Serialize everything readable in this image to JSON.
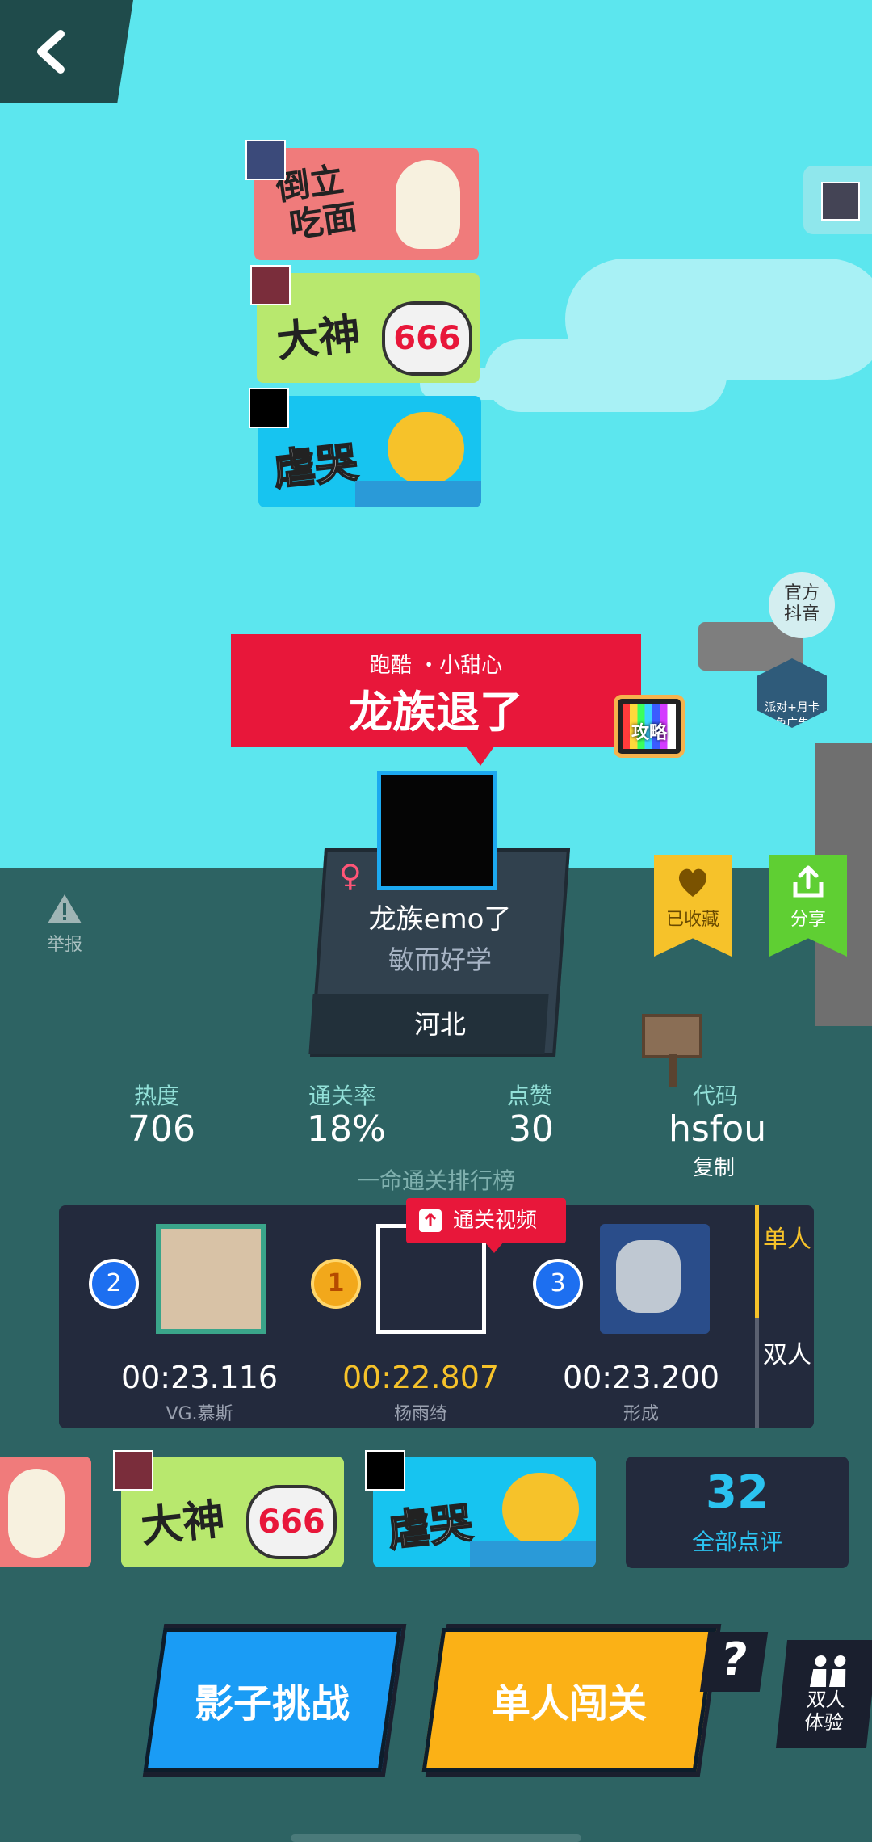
{
  "stickers_top": [
    {
      "text": "倒立\n吃面",
      "line1": "倒立",
      "line2": "吃面"
    },
    {
      "text": "大神",
      "badge": "666"
    },
    {
      "text": "虐哭"
    }
  ],
  "official": {
    "line1": "官方",
    "line2": "抖音"
  },
  "badge": {
    "text": "派对+月卡 免广告"
  },
  "guide_tv": {
    "label": "攻略"
  },
  "level": {
    "subtitle": "跑酷 ・小甜心",
    "title": "龙族退了"
  },
  "creator": {
    "gender_symbol": "♀",
    "nickname": "龙族emo了",
    "motto": "敏而好学",
    "region": "河北"
  },
  "report": {
    "label": "举报"
  },
  "favorite": {
    "label": "已收藏"
  },
  "share": {
    "label": "分享"
  },
  "stats": {
    "heat": {
      "label": "热度",
      "value": "706"
    },
    "clear_rate": {
      "label": "通关率",
      "value": "18%"
    },
    "likes": {
      "label": "点赞",
      "value": "30"
    },
    "code": {
      "label": "代码",
      "value": "hsfou",
      "copy": "复制"
    }
  },
  "ranking": {
    "title": "一命通关排行榜",
    "video_tag": "通关视频",
    "tabs": [
      "单人",
      "双人"
    ],
    "entries": [
      {
        "rank": "2",
        "time": "00:23.116",
        "name": "VG.慕斯"
      },
      {
        "rank": "1",
        "time": "00:22.807",
        "name": "杨雨绮"
      },
      {
        "rank": "3",
        "time": "00:23.200",
        "name": "形成"
      }
    ]
  },
  "stickers_bottom": [
    {
      "text": "大神",
      "badge": "666"
    },
    {
      "text": "虐哭"
    }
  ],
  "reviews": {
    "count": "32",
    "label": "全部点评"
  },
  "buttons": {
    "shadow": "影子挑战",
    "solo": "单人闯关",
    "help": "?",
    "duo_line1": "双人",
    "duo_line2": "体验"
  },
  "colors": {
    "sky": "#5ce6ee",
    "ground": "#2d6363",
    "accent_red": "#e8173a",
    "accent_blue": "#1a9cf5",
    "accent_yellow": "#fbb116",
    "gold_time": "#f6c22a"
  }
}
